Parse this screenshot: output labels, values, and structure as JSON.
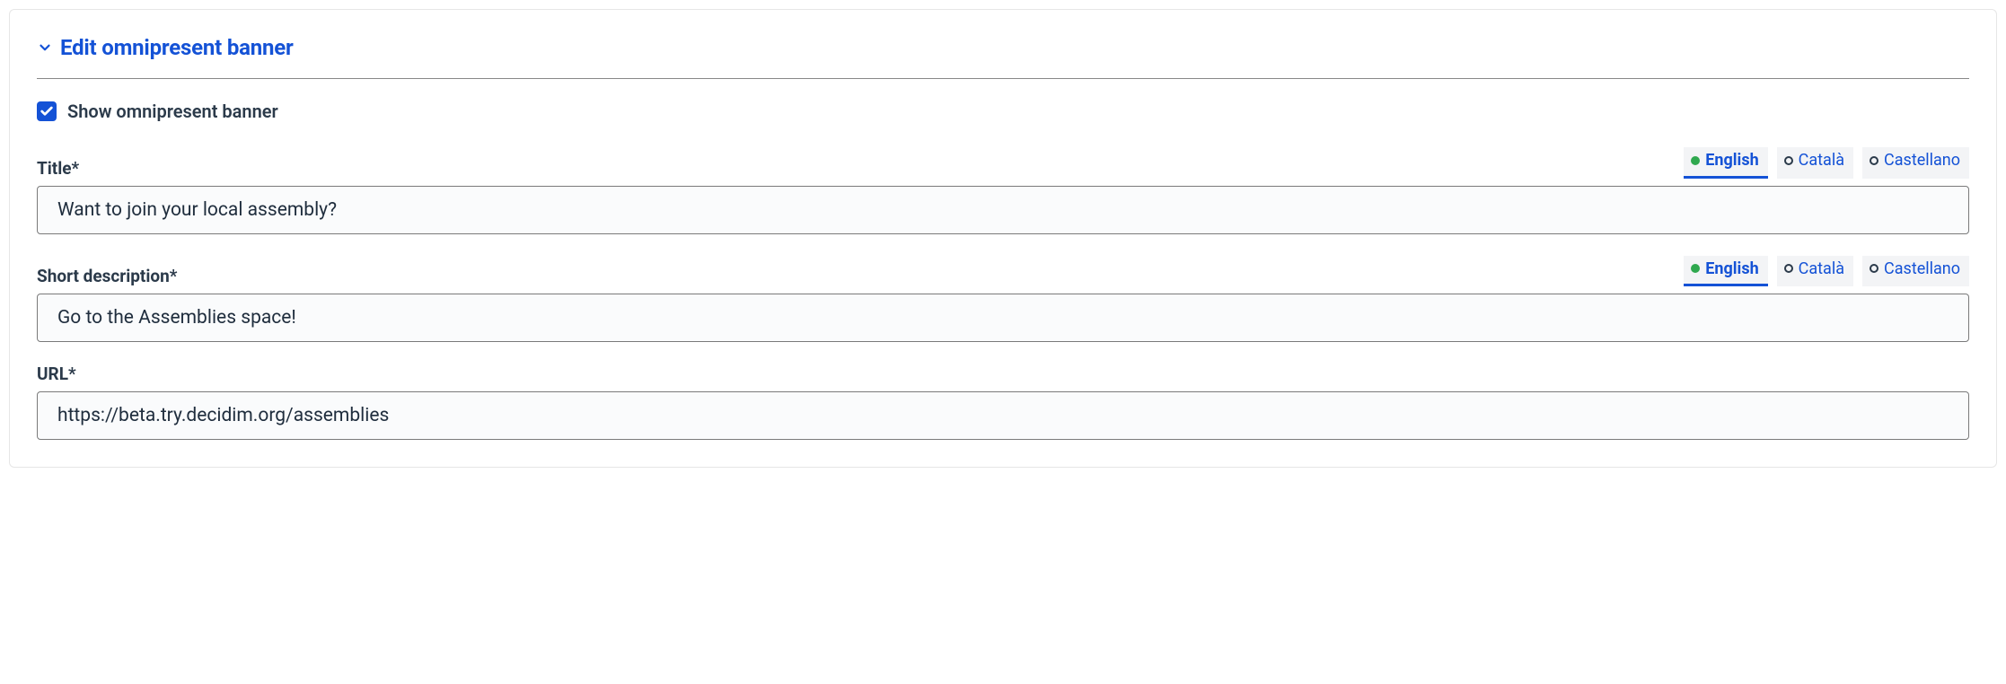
{
  "header": {
    "title": "Edit omnipresent banner"
  },
  "checkbox": {
    "checked": true,
    "label": "Show omnipresent banner"
  },
  "fields": {
    "title": {
      "label": "Title*",
      "value": "Want to join your local assembly?",
      "langs": [
        {
          "name": "English",
          "active": true,
          "filled": true
        },
        {
          "name": "Català",
          "active": false,
          "filled": false
        },
        {
          "name": "Castellano",
          "active": false,
          "filled": false
        }
      ]
    },
    "short_desc": {
      "label": "Short description*",
      "value": "Go to the Assemblies space!",
      "langs": [
        {
          "name": "English",
          "active": true,
          "filled": true
        },
        {
          "name": "Català",
          "active": false,
          "filled": false
        },
        {
          "name": "Castellano",
          "active": false,
          "filled": false
        }
      ]
    },
    "url": {
      "label": "URL*",
      "value": "https://beta.try.decidim.org/assemblies"
    }
  }
}
